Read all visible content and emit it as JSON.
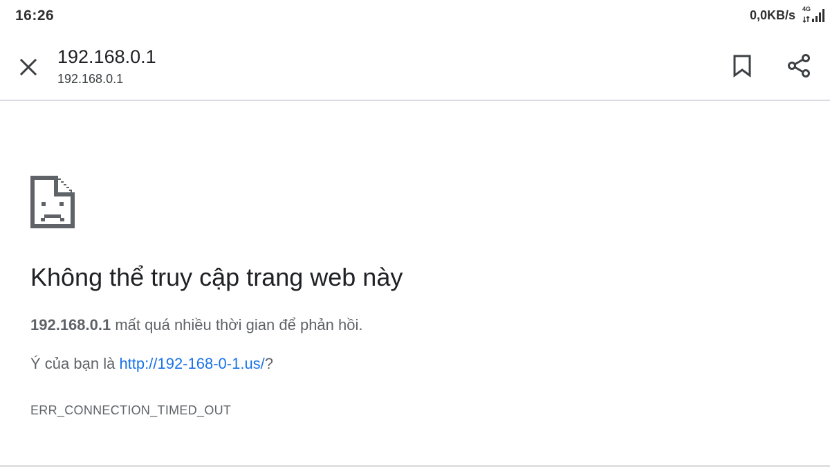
{
  "status_bar": {
    "time": "16:26",
    "net_speed": "0,0KB/s",
    "network_type": "4G"
  },
  "toolbar": {
    "title": "192.168.0.1",
    "url": "192.168.0.1",
    "icons": {
      "close": "close-icon",
      "bookmark": "bookmark-icon",
      "share": "share-icon"
    }
  },
  "error_page": {
    "icon": "sad-page-icon",
    "heading": "Không thể truy cập trang web này",
    "host": "192.168.0.1",
    "summary_rest": " mất quá nhiều thời gian để phản hồi.",
    "suggestion_prefix": "Ý của bạn là ",
    "suggestion_link": "http://192-168-0-1.us/",
    "suggestion_suffix": "?",
    "error_code": "ERR_CONNECTION_TIMED_OUT"
  },
  "colors": {
    "link": "#1a73e8",
    "text_primary": "#202124",
    "text_secondary": "#5f6368",
    "divider": "#dadce0"
  }
}
